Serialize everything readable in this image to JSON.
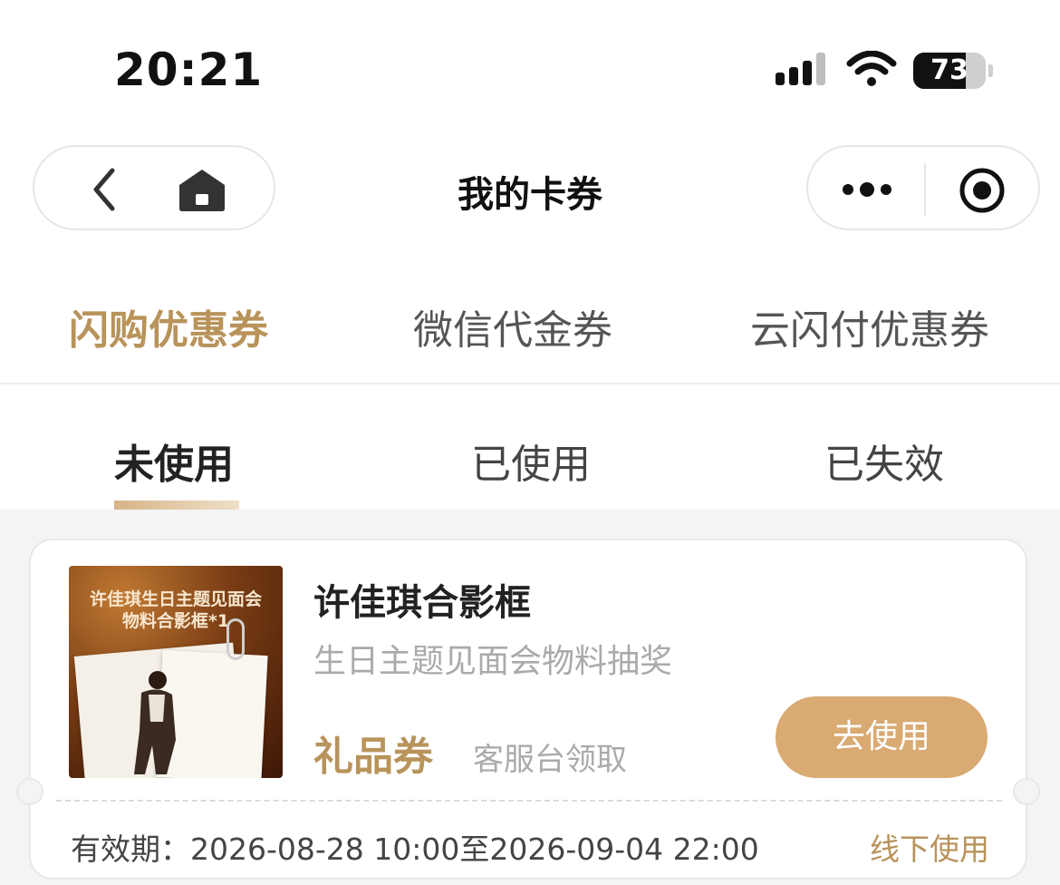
{
  "status_bar": {
    "time": "20:21",
    "battery": "73",
    "battery_level": 0.73,
    "icons": [
      "signal-icon",
      "wifi-icon",
      "battery-icon"
    ]
  },
  "nav": {
    "title": "我的卡券",
    "left_icons": [
      "back-icon",
      "home-icon"
    ],
    "right_icons": [
      "more-icon",
      "target-icon"
    ]
  },
  "top_tabs": [
    {
      "label": "闪购优惠券",
      "active": true
    },
    {
      "label": "微信代金券",
      "active": false
    },
    {
      "label": "云闪付优惠券",
      "active": false
    }
  ],
  "sub_tabs": [
    {
      "label": "未使用",
      "active": true
    },
    {
      "label": "已使用",
      "active": false
    },
    {
      "label": "已失效",
      "active": false
    }
  ],
  "coupon": {
    "thumb_line1": "许佳琪生日主题见面会",
    "thumb_line2": "物料合影框*1",
    "title": "许佳琪合影框",
    "subtitle": "生日主题见面会物料抽奖",
    "type": "礼品券",
    "method": "客服台领取",
    "button": "去使用",
    "validity": "有效期：2026-08-28 10:00至2026-09-04 22:00",
    "usage": "线下使用"
  },
  "colors": {
    "accent": "#b8935a",
    "button": "#d9aa72",
    "background": "#f3f4f6"
  }
}
